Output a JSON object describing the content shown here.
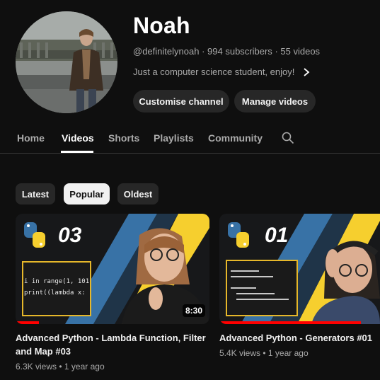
{
  "channel": {
    "name": "Noah",
    "handle": "@definitelynoah",
    "subscribers": "994 subscribers",
    "videos_count": "55 videos",
    "separator": "·",
    "description": "Just a computer science student, enjoy!"
  },
  "buttons": {
    "customise": "Customise channel",
    "manage": "Manage videos"
  },
  "tabs": [
    {
      "label": "Home"
    },
    {
      "label": "Videos"
    },
    {
      "label": "Shorts"
    },
    {
      "label": "Playlists"
    },
    {
      "label": "Community"
    }
  ],
  "active_tab": "Videos",
  "filters": [
    {
      "label": "Latest"
    },
    {
      "label": "Popular"
    },
    {
      "label": "Oldest"
    }
  ],
  "active_filter": "Popular",
  "videos": [
    {
      "thumb_number": "03",
      "code_line1": "i in range(1, 101",
      "code_line2": "print((lambda x:",
      "duration": "8:30",
      "title_line1": "Advanced Python - Lambda Function, Filter",
      "title_line2": "and Map #03",
      "views": "6.3K views",
      "age": "1 year ago",
      "watch_progress": 0.12
    },
    {
      "thumb_number": "01",
      "title_line1": "Advanced Python - Generators #01",
      "views": "5.4K views",
      "age": "1 year ago",
      "watch_progress": 0.88
    }
  ],
  "colors": {
    "background": "#0f0f0f",
    "chip": "#272727",
    "active_chip": "#f1f1f1",
    "progress": "#ff0000",
    "python_blue": "#3872a6",
    "python_yellow": "#f6cf2e"
  }
}
